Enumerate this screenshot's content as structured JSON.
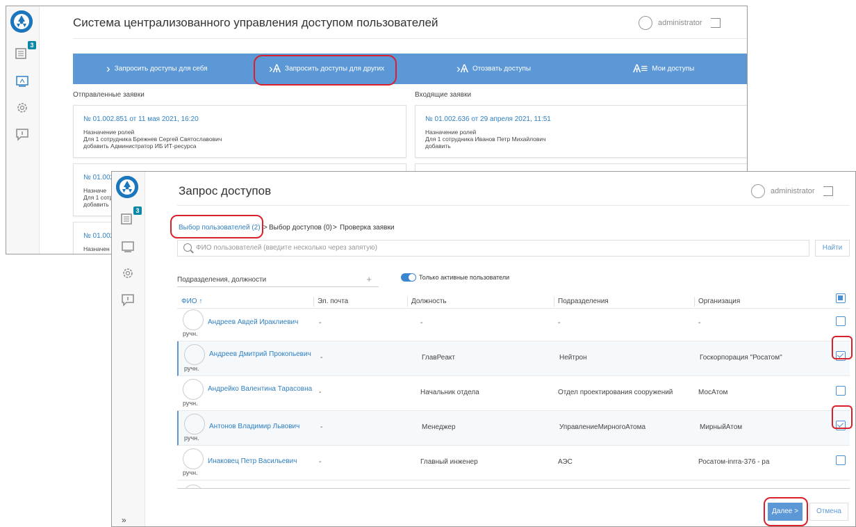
{
  "back_window": {
    "title": "Система централизованного управления доступом пользователей",
    "user": "administrator",
    "badge": "3",
    "nav": [
      {
        "icon": "chevron-right-icon",
        "glyph": "›",
        "label": "Запросить доступы для себя"
      },
      {
        "icon": "user-add-icon",
        "glyph": "›Ѧ",
        "label": "Запросить доступы для других"
      },
      {
        "icon": "user-revoke-icon",
        "glyph": "›Ѧ",
        "label": "Отозвать доступы"
      },
      {
        "icon": "user-list-icon",
        "glyph": "Ѧ≡",
        "label": "Мои доступы"
      }
    ],
    "sent_label": "Отправленные заявки",
    "incoming_label": "Входящие заявки",
    "sent_cards": [
      {
        "num": "№ 01.002.851 от 11 мая 2021, 16:20",
        "lines": [
          "Назначение ролей",
          "Для 1 сотрудника Брежнев Сергей Святославович",
          "добавить Администратор ИБ ИТ-ресурса"
        ]
      },
      {
        "num": "№ 01.002",
        "lines": [
          "Назначе",
          "Для 1 сотр",
          "добавить"
        ]
      },
      {
        "num": "№ 01.002",
        "lines": [
          "Назначен"
        ]
      }
    ],
    "incoming_cards": [
      {
        "num": "№ 01.002.636 от 29 апреля 2021, 11:51",
        "lines": [
          "Назначение ролей",
          "Для 1 сотрудника Иванов Петр Михайлович",
          "добавить"
        ]
      }
    ]
  },
  "front_window": {
    "title": "Запрос доступов",
    "user": "administrator",
    "badge": "3",
    "breadcrumb": {
      "step1": "Выбор пользователей (2)",
      "sep1": ">",
      "step2": "Выбор доступов (0)",
      "sep2": ">",
      "step3": "Проверка заявки"
    },
    "search": {
      "placeholder": "ФИО пользователей (введите несколько через запятую)"
    },
    "find_button": "Найти",
    "filter_label": "Подразделения, должности",
    "filter_plus": "+",
    "toggle_label": "Только активные пользователи",
    "toggle_on": true,
    "columns": [
      "ФИО ↑",
      "Эл. почта",
      "Должность",
      "Подразделения",
      "Организация"
    ],
    "rows": [
      {
        "name": "Андреев Авдей Ираклиевич",
        "sub": "ручн.",
        "email": "-",
        "position": "-",
        "dept": "-",
        "org": "-",
        "selected": false
      },
      {
        "name": "Андреев Дмитрий Прокопьевич",
        "sub": "ручн.",
        "email": "-",
        "position": "ГлавРеакт",
        "dept": "Нейтрон",
        "org": "Госкорпорация \"Росатом\"",
        "selected": true
      },
      {
        "name": "Андрейко Валентина Тарасовна",
        "sub": "ручн.",
        "email": "-",
        "position": "Начальник отдела",
        "dept": "Отдел проектирования сооружений",
        "org": "МосАтом",
        "selected": false
      },
      {
        "name": "Антонов Владимир Львович",
        "sub": "ручн.",
        "email": "-",
        "position": "Менеджер",
        "dept": "УправлениеМирногоАтома",
        "org": "МирныйАтом",
        "selected": true
      },
      {
        "name": "Инаковец Петр Васильевич",
        "sub": "ручн.",
        "email": "-",
        "position": "Главный инженер",
        "dept": "АЭС",
        "org": "Росатом-inrra-376 - ра",
        "selected": false
      }
    ],
    "next_button": "Далее >",
    "cancel_button": "Отмена",
    "expand": "»"
  },
  "colors": {
    "nav_bar": "#5c98d5",
    "link": "#2f7fc1",
    "highlight": "#d9202a",
    "badge": "#0a88a8"
  }
}
